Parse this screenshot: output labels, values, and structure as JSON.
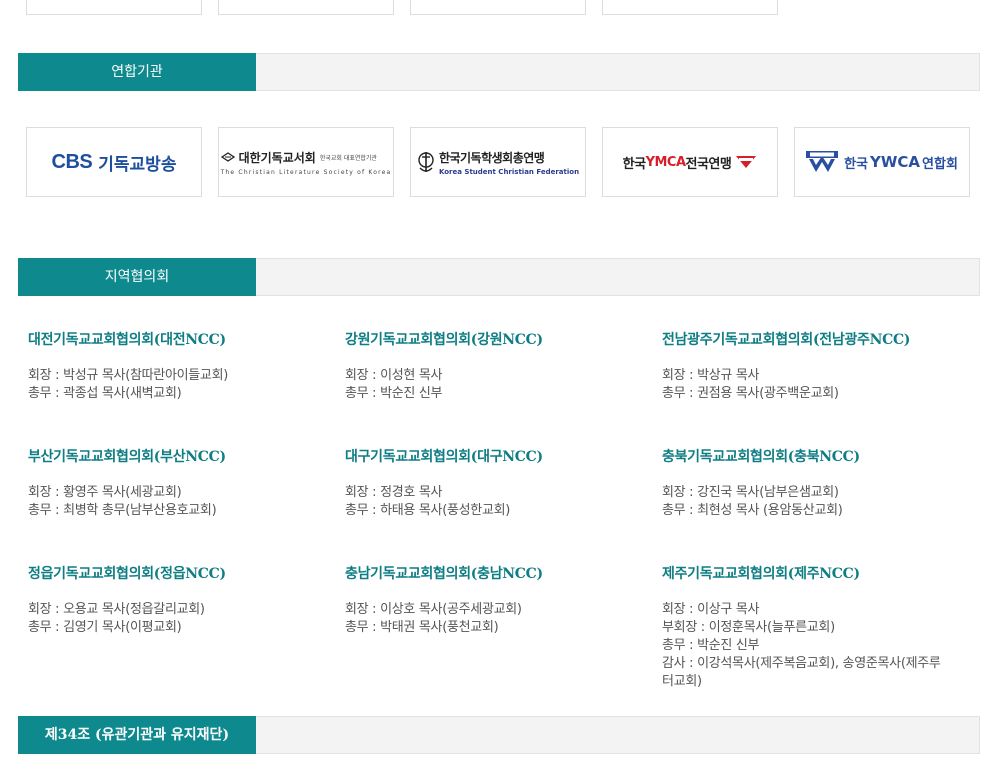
{
  "section_headers": {
    "affiliates": "연합기관",
    "regional": "지역협의회",
    "article34": "제34조 (유관기관과 유지재단)"
  },
  "logos": {
    "cbs": {
      "mark": "CBS",
      "text": "기독교방송"
    },
    "cls": {
      "main": "대한기독교서회",
      "sub": "한국교회 대표연합기관",
      "en": "The Christian Literature Society of Korea"
    },
    "kscf": {
      "main": "한국기독학생회총연맹",
      "en": "Korea Student Christian Federation"
    },
    "ymca": {
      "prefix": "한국",
      "brand": "YMCA",
      "suffix": "전국연맹",
      "badge": "YMCA"
    },
    "ywca": {
      "badge": "YWCA",
      "prefix": "한국",
      "brand": "YWCA",
      "suffix": "연합회"
    }
  },
  "regions": [
    {
      "title": "대전기독교교회협의회(대전NCC)",
      "lines": [
        "회장 : 박성규 목사(참따란아이들교회)",
        "총무 : 곽종섭 목사(새벽교회)"
      ]
    },
    {
      "title": "강원기독교교회협의회(강원NCC)",
      "lines": [
        "회장 : 이성현 목사",
        "총무 : 박순진 신부"
      ]
    },
    {
      "title": "전남광주기독교교회협의회(전남광주NCC)",
      "lines": [
        "회장 : 박상규 목사",
        "총무 : 권점용 목사(광주백운교회)"
      ]
    },
    {
      "title": "부산기독교교회협의회(부산NCC)",
      "lines": [
        "회장 : 황영주 목사(세광교회)",
        "총무 : 최병학 총무(남부산용호교회)"
      ]
    },
    {
      "title": "대구기독교교회협의회(대구NCC)",
      "lines": [
        "회장 : 정경호 목사",
        "총무 : 하태용 목사(풍성한교회)"
      ]
    },
    {
      "title": "충북기독교교회협의회(충북NCC)",
      "lines": [
        "회장 : 강진국 목사(남부은샘교회)",
        "총무 : 최현성 목사 (용암동산교회)"
      ]
    },
    {
      "title": "정읍기독교교회협의회(정읍NCC)",
      "lines": [
        "회장 : 오용교 목사(정읍갈리교회)",
        "총무 : 김영기 목사(이평교회)"
      ]
    },
    {
      "title": "충남기독교교회협의회(충남NCC)",
      "lines": [
        "회장 : 이상호 목사(공주세광교회)",
        "총무 : 박태권 목사(풍천교회)"
      ]
    },
    {
      "title": "제주기독교교회협의회(제주NCC)",
      "lines": [
        "회장 : 이상구 목사",
        "부회장 : 이정훈목사(늘푸른교회)",
        "총무 : 박순진 신부",
        "감사 : 이강석목사(제주복음교회), 송영준목사(제주루",
        "터교회)"
      ]
    }
  ],
  "colors": {
    "teal": "#0e8a8f",
    "title_teal": "#0e7d84",
    "cbs_blue": "#1e4f9c",
    "ymca_red": "#d4202a"
  }
}
